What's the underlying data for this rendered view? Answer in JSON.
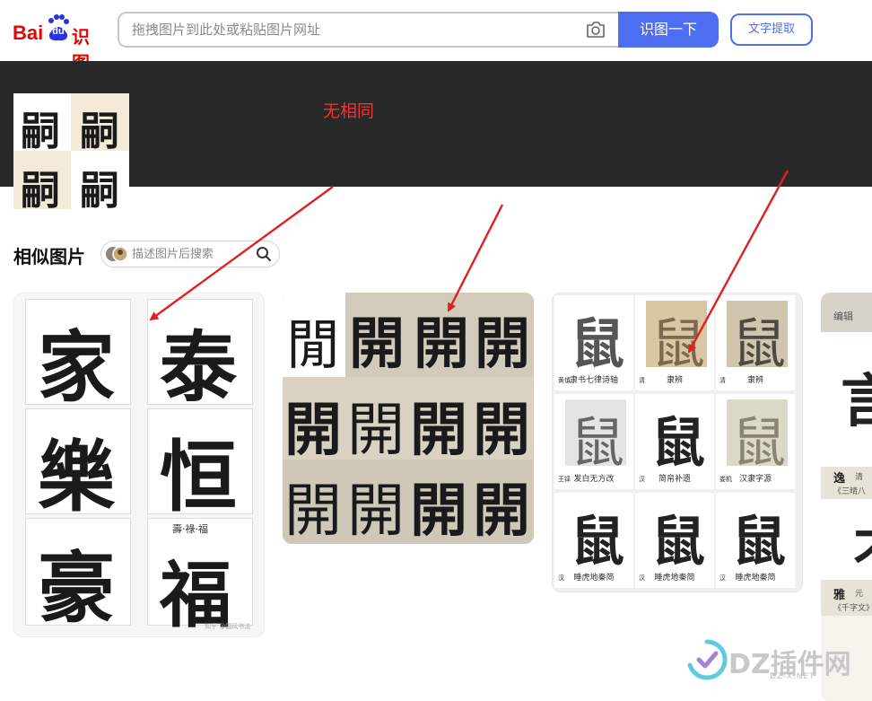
{
  "header": {
    "logo_text_bai": "Bai",
    "logo_text_du": "du",
    "logo_text_shitu": "识图",
    "search_placeholder": "拖拽图片到此处或粘贴图片网址",
    "search_button": "识图一下",
    "text_extract_button": "文字提取"
  },
  "query": {
    "annotation": "无相同",
    "thumb_chars": [
      "嗣",
      "嗣",
      "嗣",
      "嗣"
    ]
  },
  "similar": {
    "title": "相似图片",
    "search_placeholder": "描述图片后搜索"
  },
  "results": {
    "card1": {
      "chars": [
        "家",
        "泰",
        "樂",
        "恒",
        "豪",
        "福"
      ],
      "top_text": "壽·祿·福",
      "watermark": "知乎 @国风书法"
    },
    "card2": {
      "rows": [
        {
          "chars": [
            "閒",
            "開",
            "開",
            "開"
          ],
          "labels": [
            "",
            "",
            "",
            ""
          ]
        },
        {
          "chars": [
            "開",
            "開",
            "開",
            "開"
          ],
          "labels": [
            "",
            "",
            "",
            ""
          ]
        },
        {
          "chars": [
            "開",
            "開",
            "開",
            "開"
          ],
          "labels": [
            "",
            "",
            "",
            ""
          ]
        }
      ]
    },
    "card3": {
      "cells": [
        {
          "char": "鼠",
          "caption": "隶书七律诗轴",
          "tag": "黄慎"
        },
        {
          "char": "鼠",
          "caption": "隶辨",
          "tag": "清"
        },
        {
          "char": "鼠",
          "caption": "隶辨",
          "tag": "清"
        },
        {
          "char": "鼠",
          "caption": "发白无方改",
          "tag": "王铎"
        },
        {
          "char": "鼠",
          "caption": "简帛补遗",
          "tag": "汉"
        },
        {
          "char": "鼠",
          "caption": "汉隶字源",
          "tag": "娄机"
        },
        {
          "char": "鼠",
          "caption": "睡虎地秦简",
          "tag": "汉"
        },
        {
          "char": "鼠",
          "caption": "睡虎地秦简",
          "tag": "汉"
        },
        {
          "char": "鼠",
          "caption": "睡虎地秦简",
          "tag": "汉"
        }
      ]
    },
    "card4": {
      "edit_label": "编辑",
      "item1": "逸",
      "item1_sub": "《三晴八",
      "item2": "雅",
      "item2_sub": "《千字文》",
      "sub_prefix": "清",
      "sub_prefix2": "元"
    }
  },
  "watermark": {
    "main": "DZ插件网",
    "sub": "DZ-X.NET"
  },
  "colors": {
    "accent": "#4e6ef2",
    "annotation": "#ee3333",
    "dark_band": "#292929",
    "baidu_red": "#e10601",
    "baidu_blue": "#2932e1"
  }
}
